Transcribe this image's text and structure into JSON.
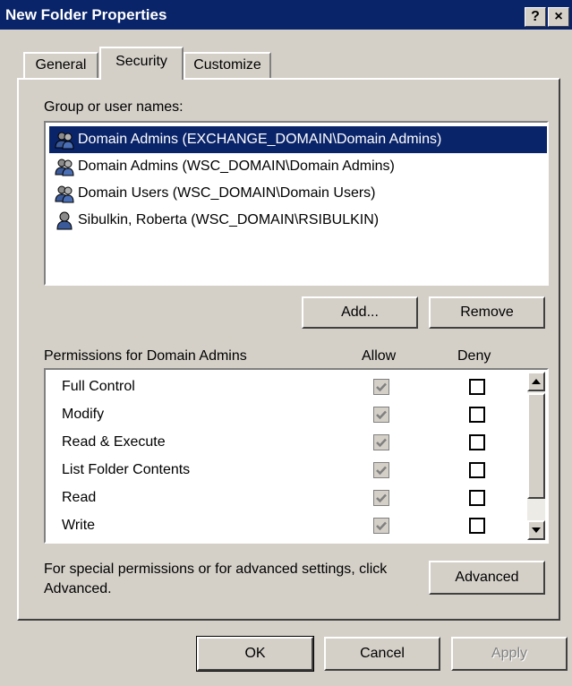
{
  "window": {
    "title": "New Folder Properties",
    "help_label": "?",
    "close_label": "×"
  },
  "tabs": [
    {
      "label": "General"
    },
    {
      "label": "Security",
      "active": true
    },
    {
      "label": "Customize"
    }
  ],
  "users": {
    "label": "Group or user names:",
    "items": [
      {
        "name": "Domain Admins (EXCHANGE_DOMAIN\\Domain Admins)",
        "icon": "group-icon",
        "selected": true
      },
      {
        "name": "Domain Admins (WSC_DOMAIN\\Domain Admins)",
        "icon": "group-icon"
      },
      {
        "name": "Domain Users (WSC_DOMAIN\\Domain Users)",
        "icon": "group-icon"
      },
      {
        "name": "Sibulkin, Roberta (WSC_DOMAIN\\RSIBULKIN)",
        "icon": "user-icon"
      }
    ]
  },
  "buttons": {
    "add": "Add...",
    "remove": "Remove",
    "advanced": "Advanced",
    "ok": "OK",
    "cancel": "Cancel",
    "apply": "Apply"
  },
  "permissions": {
    "header": "Permissions for Domain Admins",
    "allow_header": "Allow",
    "deny_header": "Deny",
    "items": [
      {
        "name": "Full Control",
        "allow": true,
        "allow_inherited": true,
        "deny": false
      },
      {
        "name": "Modify",
        "allow": true,
        "allow_inherited": true,
        "deny": false
      },
      {
        "name": "Read & Execute",
        "allow": true,
        "allow_inherited": true,
        "deny": false
      },
      {
        "name": "List Folder Contents",
        "allow": true,
        "allow_inherited": true,
        "deny": false
      },
      {
        "name": "Read",
        "allow": true,
        "allow_inherited": true,
        "deny": false
      },
      {
        "name": "Write",
        "allow": true,
        "allow_inherited": true,
        "deny": false
      }
    ]
  },
  "advanced_text": "For special permissions or for advanced settings, click Advanced.",
  "colors": {
    "titlebar": "#0a246a",
    "selection": "#0a246a",
    "face": "#d4d0c8"
  }
}
